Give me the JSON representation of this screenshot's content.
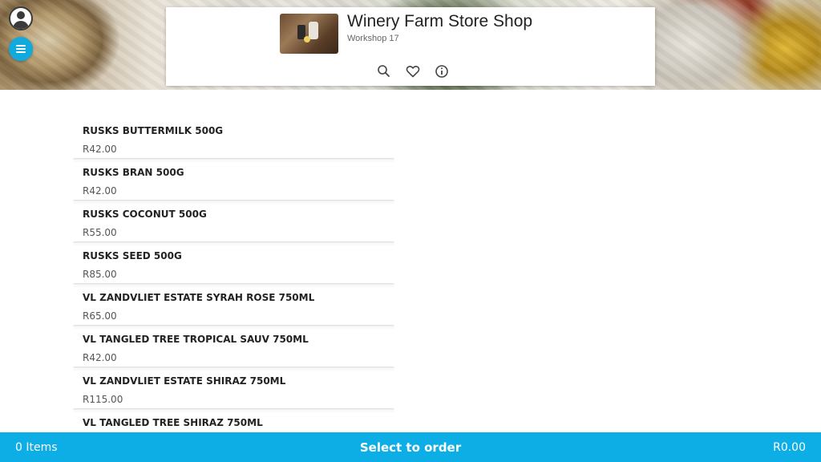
{
  "header": {
    "store_name": "Winery Farm Store Shop",
    "store_location": "Workshop 17",
    "icons": [
      "search-icon",
      "heart-icon",
      "info-icon"
    ]
  },
  "side_controls": {
    "account_icon": "account-circle-icon",
    "menu_icon": "menu-icon",
    "menu_color": "#12a9dd"
  },
  "products": [
    {
      "name": "RUSKS BUTTERMILK 500G",
      "price": "R42.00"
    },
    {
      "name": "RUSKS BRAN 500G",
      "price": "R42.00"
    },
    {
      "name": "RUSKS COCONUT 500G",
      "price": "R55.00"
    },
    {
      "name": "RUSKS SEED 500G",
      "price": "R85.00"
    },
    {
      "name": "VL ZANDVLIET ESTATE SYRAH ROSE 750ML",
      "price": "R65.00"
    },
    {
      "name": "VL TANGLED TREE TROPICAL SAUV 750ML",
      "price": "R42.00"
    },
    {
      "name": "VL ZANDVLIET ESTATE SHIRAZ 750ML",
      "price": "R115.00"
    },
    {
      "name": "VL TANGLED TREE SHIRAZ 750ML",
      "price": ""
    }
  ],
  "footer": {
    "items_count": "0 Items",
    "cta_label": "Select to order",
    "total": "R0.00",
    "bar_color": "#0daee6"
  }
}
